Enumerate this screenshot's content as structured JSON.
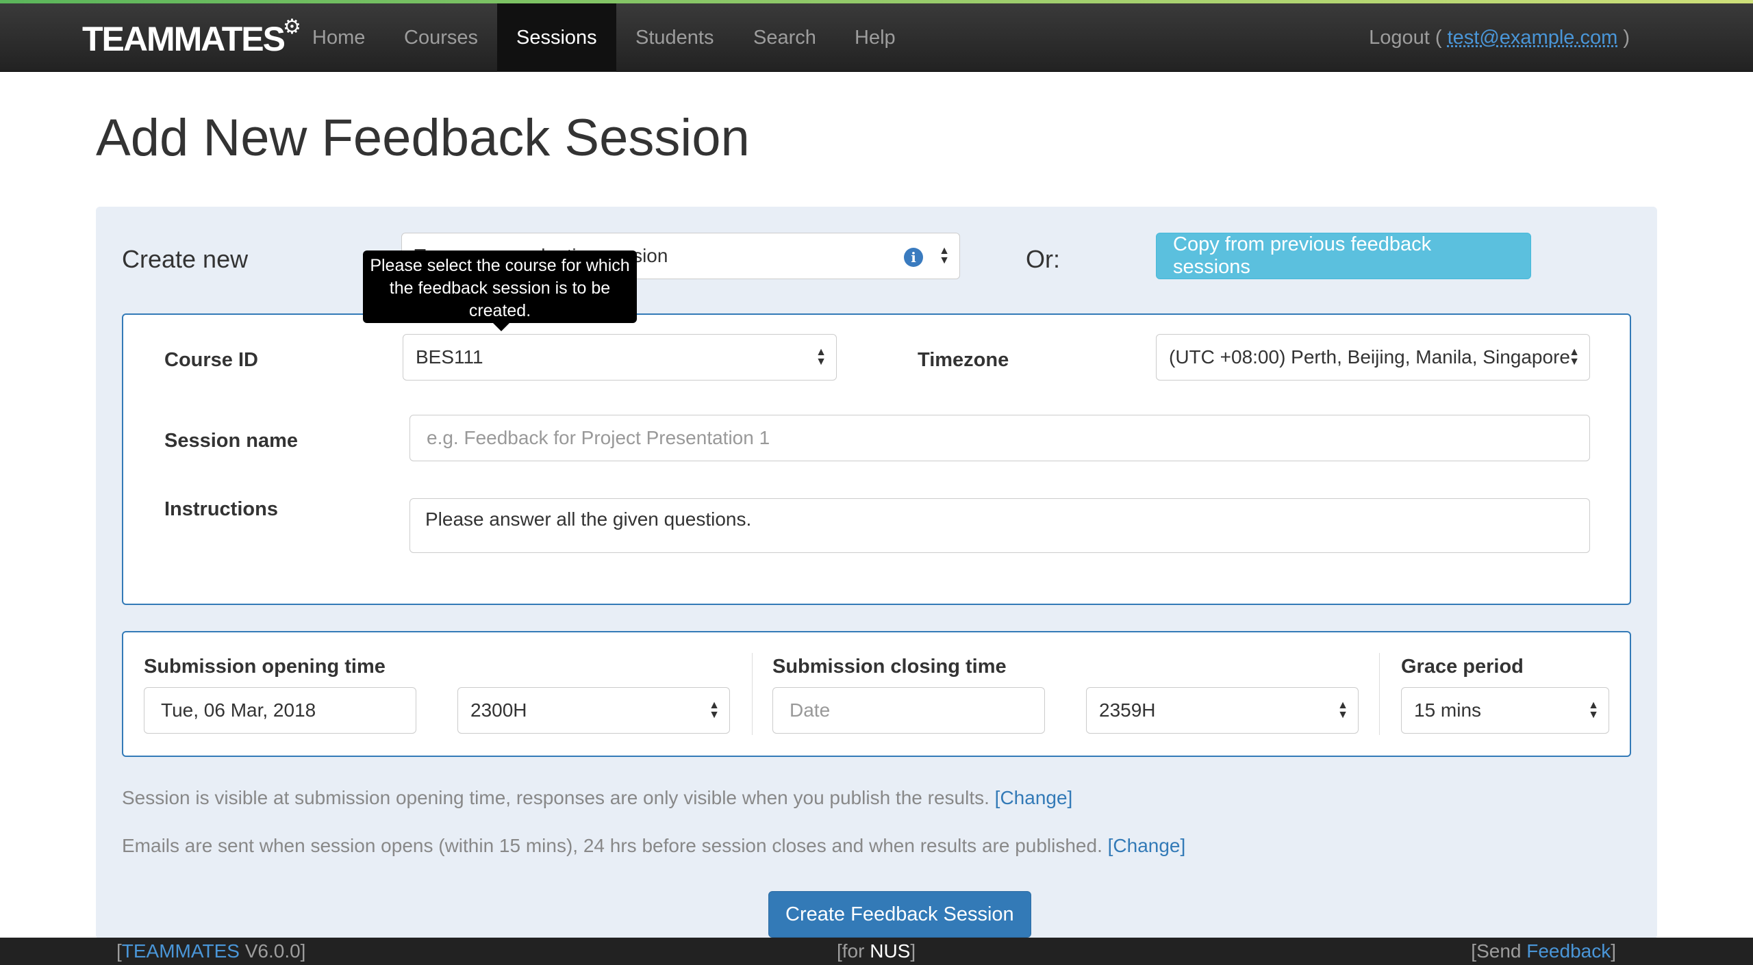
{
  "navbar": {
    "brand": "TEAMMATES",
    "items": [
      "Home",
      "Courses",
      "Sessions",
      "Students",
      "Search",
      "Help"
    ],
    "active": "Sessions",
    "logout_prefix": "Logout (",
    "logout_email": "test@example.com",
    "logout_suffix": ")"
  },
  "page_title": "Add New Feedback Session",
  "create": {
    "label": "Create new",
    "template_select": "Team peer evaluation session",
    "or_label": "Or:",
    "copy_button": "Copy from previous feedback sessions"
  },
  "tooltip": "Please select the course for which the feedback session is to be created.",
  "form": {
    "course_label": "Course ID",
    "course_value": "BES111",
    "timezone_label": "Timezone",
    "timezone_value": "(UTC +08:00) Perth, Beijing, Manila, Singapore",
    "session_name_label": "Session name",
    "session_name_placeholder": "e.g. Feedback for Project Presentation 1",
    "instructions_label": "Instructions",
    "instructions_value": "Please answer all the given questions."
  },
  "times": {
    "opening_label": "Submission opening time",
    "opening_date": "Tue, 06 Mar, 2018",
    "opening_time": "2300H",
    "closing_label": "Submission closing time",
    "closing_date_placeholder": "Date",
    "closing_time": "2359H",
    "grace_label": "Grace period",
    "grace_value": "15 mins"
  },
  "notes": {
    "visibility": "Session is visible at submission opening time, responses are only visible when you publish the results.",
    "emails": "Emails are sent when session opens (within 15 mins), 24 hrs before session closes and when results are published.",
    "change": "[Change]"
  },
  "create_button": "Create Feedback Session",
  "footer": {
    "left_open": "[",
    "left_link": "TEAMMATES",
    "left_version": " V6.0.0]",
    "mid_open": "[for ",
    "mid_org": "NUS",
    "mid_close": "]",
    "right_open": "[Send ",
    "right_link": "Feedback",
    "right_close": "]"
  }
}
